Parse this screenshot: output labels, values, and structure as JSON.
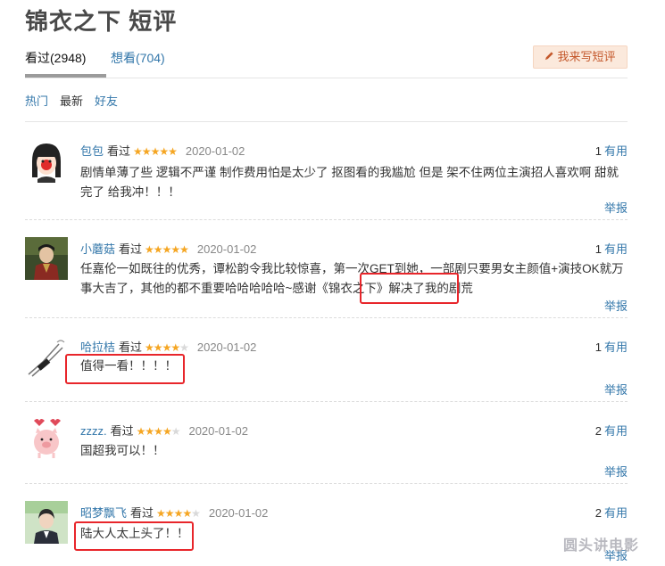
{
  "page": {
    "title": "锦衣之下 短评"
  },
  "tabs": [
    {
      "label": "看过(2948)",
      "active": true
    },
    {
      "label": "想看(704)",
      "active": false
    }
  ],
  "write_button": {
    "label": "我来写短评",
    "icon": "pencil-icon"
  },
  "sorts": [
    "热门",
    "最新",
    "好友"
  ],
  "reviews": [
    {
      "user": "包包",
      "status": "看过",
      "rating": 5,
      "date": "2020-01-02",
      "votes": "1",
      "votes_label": "有用",
      "content": "剧情单薄了些 逻辑不严谨 制作费用怕是太少了 抠图看的我尴尬 但是 架不住两位主演招人喜欢啊 甜就完了 给我冲！！！",
      "report": "举报"
    },
    {
      "user": "小蘑菇",
      "status": "看过",
      "rating": 5,
      "date": "2020-01-02",
      "votes": "1",
      "votes_label": "有用",
      "content": "任嘉伦一如既往的优秀，谭松韵令我比较惊喜，第一次GET到她，一部剧只要男女主颜值+演技OK就万事大吉了，其他的都不重要哈哈哈哈哈~感谢《锦衣之下》解决了我的剧荒",
      "report": "举报"
    },
    {
      "user": "哈拉桔",
      "status": "看过",
      "rating": 4,
      "date": "2020-01-02",
      "votes": "1",
      "votes_label": "有用",
      "content": "值得一看！！！！",
      "report": "举报"
    },
    {
      "user": "zzzz.",
      "status": "看过",
      "rating": 4,
      "date": "2020-01-02",
      "votes": "2",
      "votes_label": "有用",
      "content": "国超我可以！！",
      "report": "举报"
    },
    {
      "user": "昭梦飘飞",
      "status": "看过",
      "rating": 4,
      "date": "2020-01-02",
      "votes": "2",
      "votes_label": "有用",
      "content": "陆大人太上头了！！",
      "report": "举报"
    }
  ],
  "watermark": "圆头讲电影",
  "colors": {
    "link": "#3377aa",
    "star": "#f5a623",
    "highlight": "#e8262b",
    "write_button_bg": "#fbe9dc"
  }
}
